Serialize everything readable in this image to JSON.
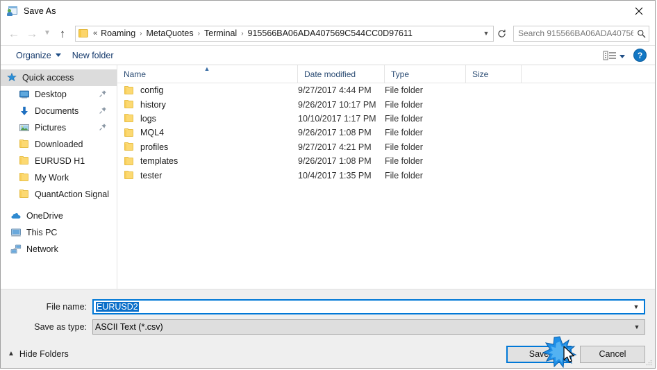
{
  "window": {
    "title": "Save As",
    "title_icon": "save-as-app-icon",
    "close_icon": "close-icon"
  },
  "navbar": {
    "back_icon": "back-arrow-icon",
    "forward_icon": "forward-arrow-icon",
    "recent_icon": "chevron-down-icon",
    "up_icon": "up-arrow-icon",
    "folder_icon": "folder-icon",
    "breadcrumb_lead": "«",
    "breadcrumbs": [
      "Roaming",
      "MetaQuotes",
      "Terminal",
      "915566BA06ADA407569C544CC0D97611"
    ],
    "breadcrumb_separator": "›",
    "address_dropdown_icon": "chevron-down-icon",
    "refresh_icon": "refresh-icon",
    "search_placeholder": "Search 915566BA06ADA40756...",
    "search_icon": "search-icon"
  },
  "toolbar": {
    "organize_label": "Organize",
    "organize_caret_icon": "caret-down-icon",
    "new_folder_label": "New folder",
    "view_icon": "view-layout-icon",
    "view_caret_icon": "caret-down-icon",
    "help_label": "?",
    "help_icon": "help-icon"
  },
  "sidebar": {
    "items": [
      {
        "label": "Quick access",
        "icon": "quick-access-star-icon",
        "selected": true,
        "indent": 0,
        "pinned": false
      },
      {
        "label": "Desktop",
        "icon": "desktop-monitor-icon",
        "selected": false,
        "indent": 1,
        "pinned": true
      },
      {
        "label": "Documents",
        "icon": "documents-download-icon",
        "selected": false,
        "indent": 1,
        "pinned": true
      },
      {
        "label": "Pictures",
        "icon": "pictures-icon",
        "selected": false,
        "indent": 1,
        "pinned": true
      },
      {
        "label": "Downloaded",
        "icon": "folder-icon",
        "selected": false,
        "indent": 1,
        "pinned": false
      },
      {
        "label": "EURUSD H1",
        "icon": "folder-icon",
        "selected": false,
        "indent": 1,
        "pinned": false
      },
      {
        "label": "My Work",
        "icon": "folder-icon",
        "selected": false,
        "indent": 1,
        "pinned": false
      },
      {
        "label": "QuantAction Signal",
        "icon": "folder-icon",
        "selected": false,
        "indent": 1,
        "pinned": false
      }
    ],
    "roots": [
      {
        "label": "OneDrive",
        "icon": "onedrive-cloud-icon"
      },
      {
        "label": "This PC",
        "icon": "this-pc-icon"
      },
      {
        "label": "Network",
        "icon": "network-icon"
      }
    ]
  },
  "filelist": {
    "columns": [
      "Name",
      "Date modified",
      "Type",
      "Size"
    ],
    "sort_column": "Name",
    "sort_caret_icon": "caret-up-icon",
    "rows": [
      {
        "name": "config",
        "date": "9/27/2017 4:44 PM",
        "type": "File folder",
        "size": "",
        "icon": "folder-icon"
      },
      {
        "name": "history",
        "date": "9/26/2017 10:17 PM",
        "type": "File folder",
        "size": "",
        "icon": "folder-icon"
      },
      {
        "name": "logs",
        "date": "10/10/2017 1:17 PM",
        "type": "File folder",
        "size": "",
        "icon": "folder-icon"
      },
      {
        "name": "MQL4",
        "date": "9/26/2017 1:08 PM",
        "type": "File folder",
        "size": "",
        "icon": "folder-icon"
      },
      {
        "name": "profiles",
        "date": "9/27/2017 4:21 PM",
        "type": "File folder",
        "size": "",
        "icon": "folder-icon"
      },
      {
        "name": "templates",
        "date": "9/26/2017 1:08 PM",
        "type": "File folder",
        "size": "",
        "icon": "folder-icon"
      },
      {
        "name": "tester",
        "date": "10/4/2017 1:35 PM",
        "type": "File folder",
        "size": "",
        "icon": "folder-icon"
      }
    ]
  },
  "form": {
    "filename_label": "File name:",
    "filename_value": "EURUSD2",
    "filename_dropdown_icon": "chevron-down-icon",
    "filetype_label": "Save as type:",
    "filetype_value": "ASCII Text (*.csv)",
    "filetype_dropdown_icon": "chevron-down-icon"
  },
  "footer": {
    "hide_folders_label": "Hide Folders",
    "hide_folders_icon": "caret-up-icon",
    "save_label": "Save",
    "cancel_label": "Cancel",
    "resize_grip_icon": "resize-grip-icon",
    "click_indicator_icon": "click-burst-icon",
    "cursor_icon": "mouse-cursor-icon"
  },
  "colors": {
    "accent": "#0078d7",
    "selection": "#0b6fc9",
    "folder": "#fcd56b",
    "header_text": "#2a4b73"
  }
}
